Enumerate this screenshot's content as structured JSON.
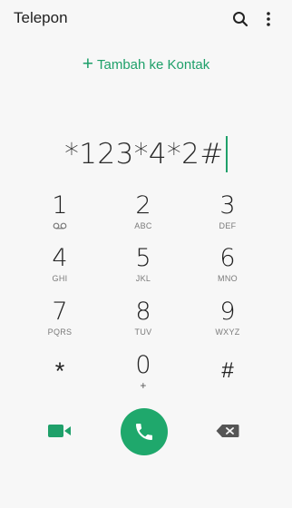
{
  "header": {
    "title": "Telepon",
    "search_icon": "search-icon",
    "more_icon": "more-vertical-icon"
  },
  "add_contact": {
    "plus": "+",
    "label": "Tambah ke Kontak"
  },
  "dial_input": {
    "value": "*123*4*2#"
  },
  "keypad": {
    "keys": [
      {
        "digit": "1",
        "sub": "voicemail-icon"
      },
      {
        "digit": "2",
        "sub": "ABC"
      },
      {
        "digit": "3",
        "sub": "DEF"
      },
      {
        "digit": "4",
        "sub": "GHI"
      },
      {
        "digit": "5",
        "sub": "JKL"
      },
      {
        "digit": "6",
        "sub": "MNO"
      },
      {
        "digit": "7",
        "sub": "PQRS"
      },
      {
        "digit": "8",
        "sub": "TUV"
      },
      {
        "digit": "9",
        "sub": "WXYZ"
      },
      {
        "digit": "*",
        "sub": ""
      },
      {
        "digit": "0",
        "sub": "+"
      },
      {
        "digit": "#",
        "sub": ""
      }
    ]
  },
  "actions": {
    "video_icon": "video-call-icon",
    "call_icon": "phone-icon",
    "backspace_icon": "backspace-icon"
  },
  "colors": {
    "accent": "#1fa06a",
    "call_button": "#1fa86c",
    "background": "#f7f7f7"
  }
}
